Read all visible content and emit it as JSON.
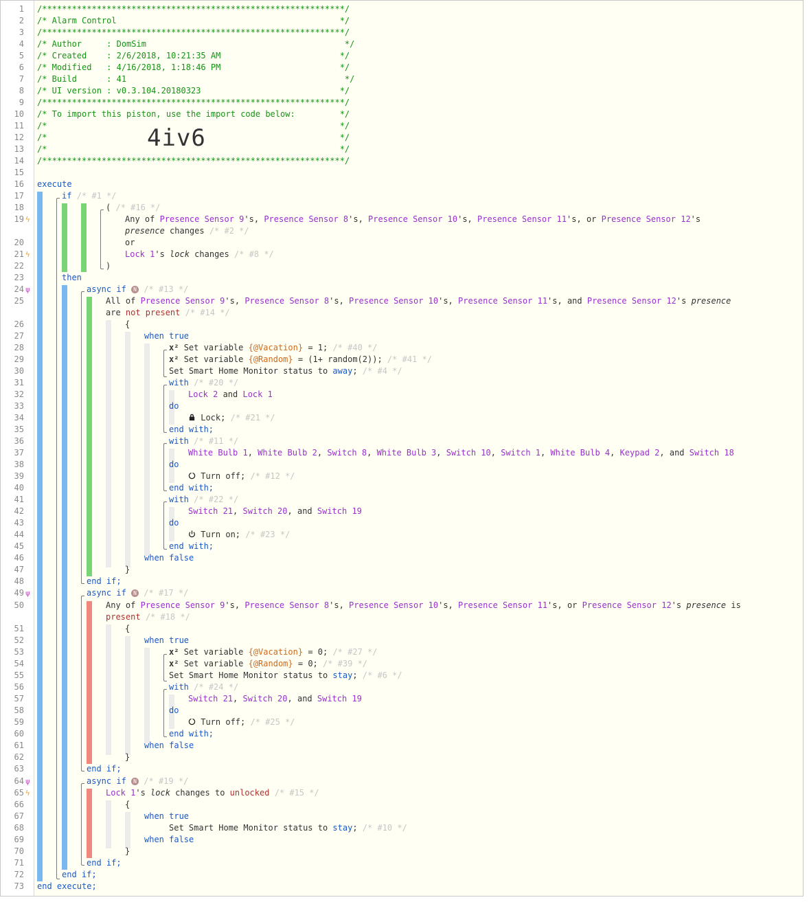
{
  "editor": {
    "header": {
      "stars": "/*************************************************************/",
      "title": "/* Alarm Control                                             */",
      "author": "/* Author     : DomSim                                        */",
      "created": "/* Created    : 2/6/2018, 10:21:35 AM                        */",
      "modified": "/* Modified   : 4/16/2018, 1:18:46 PM                        */",
      "build": "/* Build      : 41                                            */",
      "ui_version": "/* UI version : v0.3.104.20180323                            */",
      "import_text": "/* To import this piston, use the import code below:         */",
      "blank": "/*                                                           */",
      "import_code": "4iv6"
    },
    "kw": {
      "execute": "execute",
      "if": "if",
      "then": "then",
      "async_if": "async if",
      "end_if": "end if;",
      "end_execute": "end execute;",
      "with": "with",
      "do": "do",
      "end_with": "end with;",
      "when_true": "when true",
      "when_false": "when false",
      "open_brace": "{",
      "close_brace": "}",
      "open_paren": "(",
      "close_paren": ")",
      "or": "or",
      "badge": "N"
    },
    "devices": {
      "ps9": "Presence Sensor 9",
      "ps8": "Presence Sensor 8",
      "ps10": "Presence Sensor 10",
      "ps11": "Presence Sensor 11",
      "ps12": "Presence Sensor 12",
      "lock1": "Lock 1",
      "lock2": "Lock 2",
      "wb1": "White Bulb 1",
      "wb2": "White Bulb 2",
      "sw8": "Switch 8",
      "wb3": "White Bulb 3",
      "sw10": "Switch 10",
      "sw1": "Switch 1",
      "wb4": "White Bulb 4",
      "kp2": "Keypad 2",
      "sw18": "Switch 18",
      "sw21": "Switch 21",
      "sw20": "Switch 20",
      "sw19": "Switch 19"
    },
    "vars": {
      "vacation": "{@Vacation}",
      "random": "{@Random}"
    },
    "comments": {
      "c1": "/* #1 */",
      "c16": "/* #16 */",
      "c2": "/* #2 */",
      "c8": "/* #8 */",
      "c13": "/* #13 */",
      "c14": "/* #14 */",
      "c40": "/* #40 */",
      "c41": "/* #41 */",
      "c4": "/* #4 */",
      "c20": "/* #20 */",
      "c21": "/* #21 */",
      "c11": "/* #11 */",
      "c12": "/* #12 */",
      "c22": "/* #22 */",
      "c23": "/* #23 */",
      "c17": "/* #17 */",
      "c18": "/* #18 */",
      "c27": "/* #27 */",
      "c39": "/* #39 */",
      "c6": "/* #6 */",
      "c24": "/* #24 */",
      "c25": "/* #25 */",
      "c19": "/* #19 */",
      "c15": "/* #15 */",
      "c10": "/* #10 */"
    },
    "text": {
      "any_of": "Any of ",
      "all_of": "All of ",
      "s_comma": "'s, ",
      "s_or": "'s, or ",
      "s_and": "'s, and ",
      "s": "'s ",
      "s_end": "'s",
      "presence": "presence",
      "lock": "lock",
      "changes": " changes ",
      "changes_to": " changes to ",
      "unlocked": "unlocked",
      "are": "are ",
      "not_present": "not present",
      "is": " is",
      "present": "present",
      "set_variable": "Set variable ",
      "eq_1": " = 1;",
      "eq_0": " = 0;",
      "eq_random": " = (1+ random(2));",
      "shm_status": "Set Smart Home Monitor status to ",
      "away": "away",
      "stay": "stay",
      "semi": ";",
      "and": " and ",
      "comma": ", ",
      "comma_and": ", and ",
      "lock_cmd": "Lock;",
      "turn_off": "Turn off;",
      "turn_on": "Turn on;",
      "x2": "x²"
    }
  }
}
